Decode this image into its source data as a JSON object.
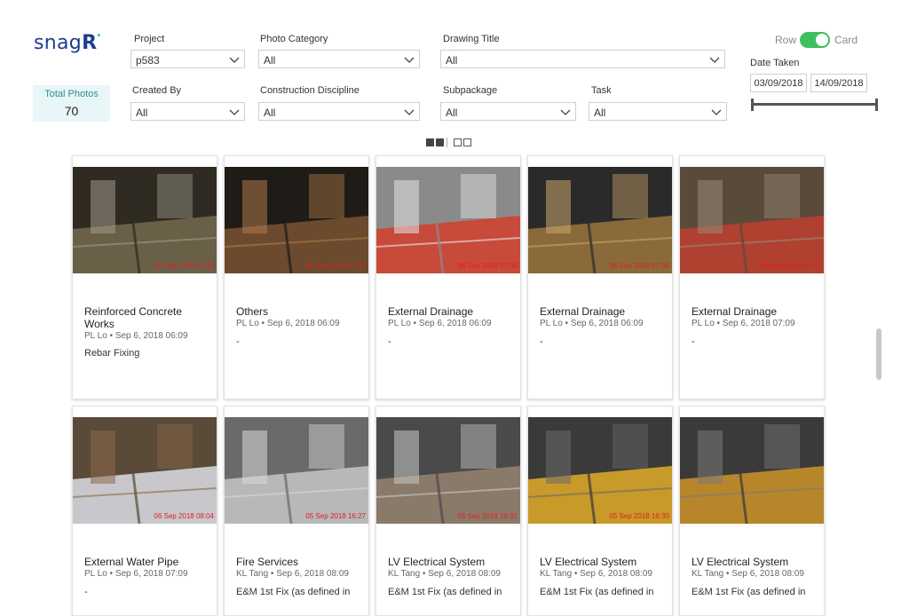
{
  "logo": {
    "text": "snag",
    "r": "R",
    "dot": "•"
  },
  "stat": {
    "label": "Total Photos",
    "value": "70"
  },
  "filters": {
    "project": {
      "label": "Project",
      "value": "p583"
    },
    "photo_category": {
      "label": "Photo Category",
      "value": "All"
    },
    "drawing_title": {
      "label": "Drawing Title",
      "value": "All"
    },
    "created_by": {
      "label": "Created By",
      "value": "All"
    },
    "construction_discipline": {
      "label": "Construction Discipline",
      "value": "All"
    },
    "subpackage": {
      "label": "Subpackage",
      "value": "All"
    },
    "task": {
      "label": "Task",
      "value": "All"
    }
  },
  "view_toggle": {
    "row_label": "Row",
    "card_label": "Card",
    "selected": "Card"
  },
  "date_taken": {
    "label": "Date Taken",
    "from": "03/09/2018",
    "to": "14/09/2018"
  },
  "paging": {
    "current": 1
  },
  "cards": [
    {
      "title": "Reinforced Concrete Works",
      "meta": "PL Lo • Sep 6, 2018 06:09",
      "task": "Rebar Fixing",
      "stamp": "06 Sep 2018 07:48",
      "palette": [
        "#2f2a22",
        "#6a6048",
        "#a09a8a"
      ]
    },
    {
      "title": "Others",
      "meta": "PL Lo • Sep 6, 2018 06:09",
      "task": "-",
      "stamp": "06 Sep 2018 07:47",
      "palette": [
        "#1f1c18",
        "#6b4a2e",
        "#b07a4a"
      ]
    },
    {
      "title": "External Drainage",
      "meta": "PL Lo • Sep 6, 2018 06:09",
      "task": "-",
      "stamp": "06 Sep 2018 07:46",
      "palette": [
        "#8a8a8a",
        "#c84a3a",
        "#e6e6e6"
      ]
    },
    {
      "title": "External Drainage",
      "meta": "PL Lo • Sep 6, 2018 06:09",
      "task": "-",
      "stamp": "06 Sep 2018 07:48",
      "palette": [
        "#2a2a2a",
        "#8a6a3a",
        "#c9a56a"
      ]
    },
    {
      "title": "External Drainage",
      "meta": "PL Lo • Sep 6, 2018 07:09",
      "task": "-",
      "stamp": "06 Sep 2018 07:52",
      "palette": [
        "#5a4a3a",
        "#b04030",
        "#9a8a78"
      ]
    },
    {
      "title": "External Water Pipe",
      "meta": "PL Lo • Sep 6, 2018 07:09",
      "task": "-",
      "stamp": "06 Sep 2018 08:04",
      "palette": [
        "#5a4a38",
        "#c8c8cc",
        "#8a6a4a"
      ]
    },
    {
      "title": "Fire Services",
      "meta": "KL Tang • Sep 6, 2018 08:09",
      "task": "E&M 1st Fix (as defined in",
      "stamp": "05 Sep 2018 16:27",
      "palette": [
        "#6a6a6a",
        "#b8b8b8",
        "#d8d8d8"
      ]
    },
    {
      "title": "LV Electrical System",
      "meta": "KL Tang • Sep 6, 2018 08:09",
      "task": "E&M 1st Fix (as defined in",
      "stamp": "05 Sep 2018 16:31",
      "palette": [
        "#4a4a4a",
        "#8a7a6a",
        "#c8c8c8"
      ]
    },
    {
      "title": "LV Electrical System",
      "meta": "KL Tang • Sep 6, 2018 08:09",
      "task": "E&M 1st Fix (as defined in",
      "stamp": "05 Sep 2018 16:30",
      "palette": [
        "#3a3a3a",
        "#c89a2a",
        "#6a6a6a"
      ]
    },
    {
      "title": "LV Electrical System",
      "meta": "KL Tang • Sep 6, 2018 08:09",
      "task": "E&M 1st Fix (as defined in",
      "stamp": "",
      "palette": [
        "#3a3a3a",
        "#b8862a",
        "#7a7a7a"
      ]
    }
  ]
}
